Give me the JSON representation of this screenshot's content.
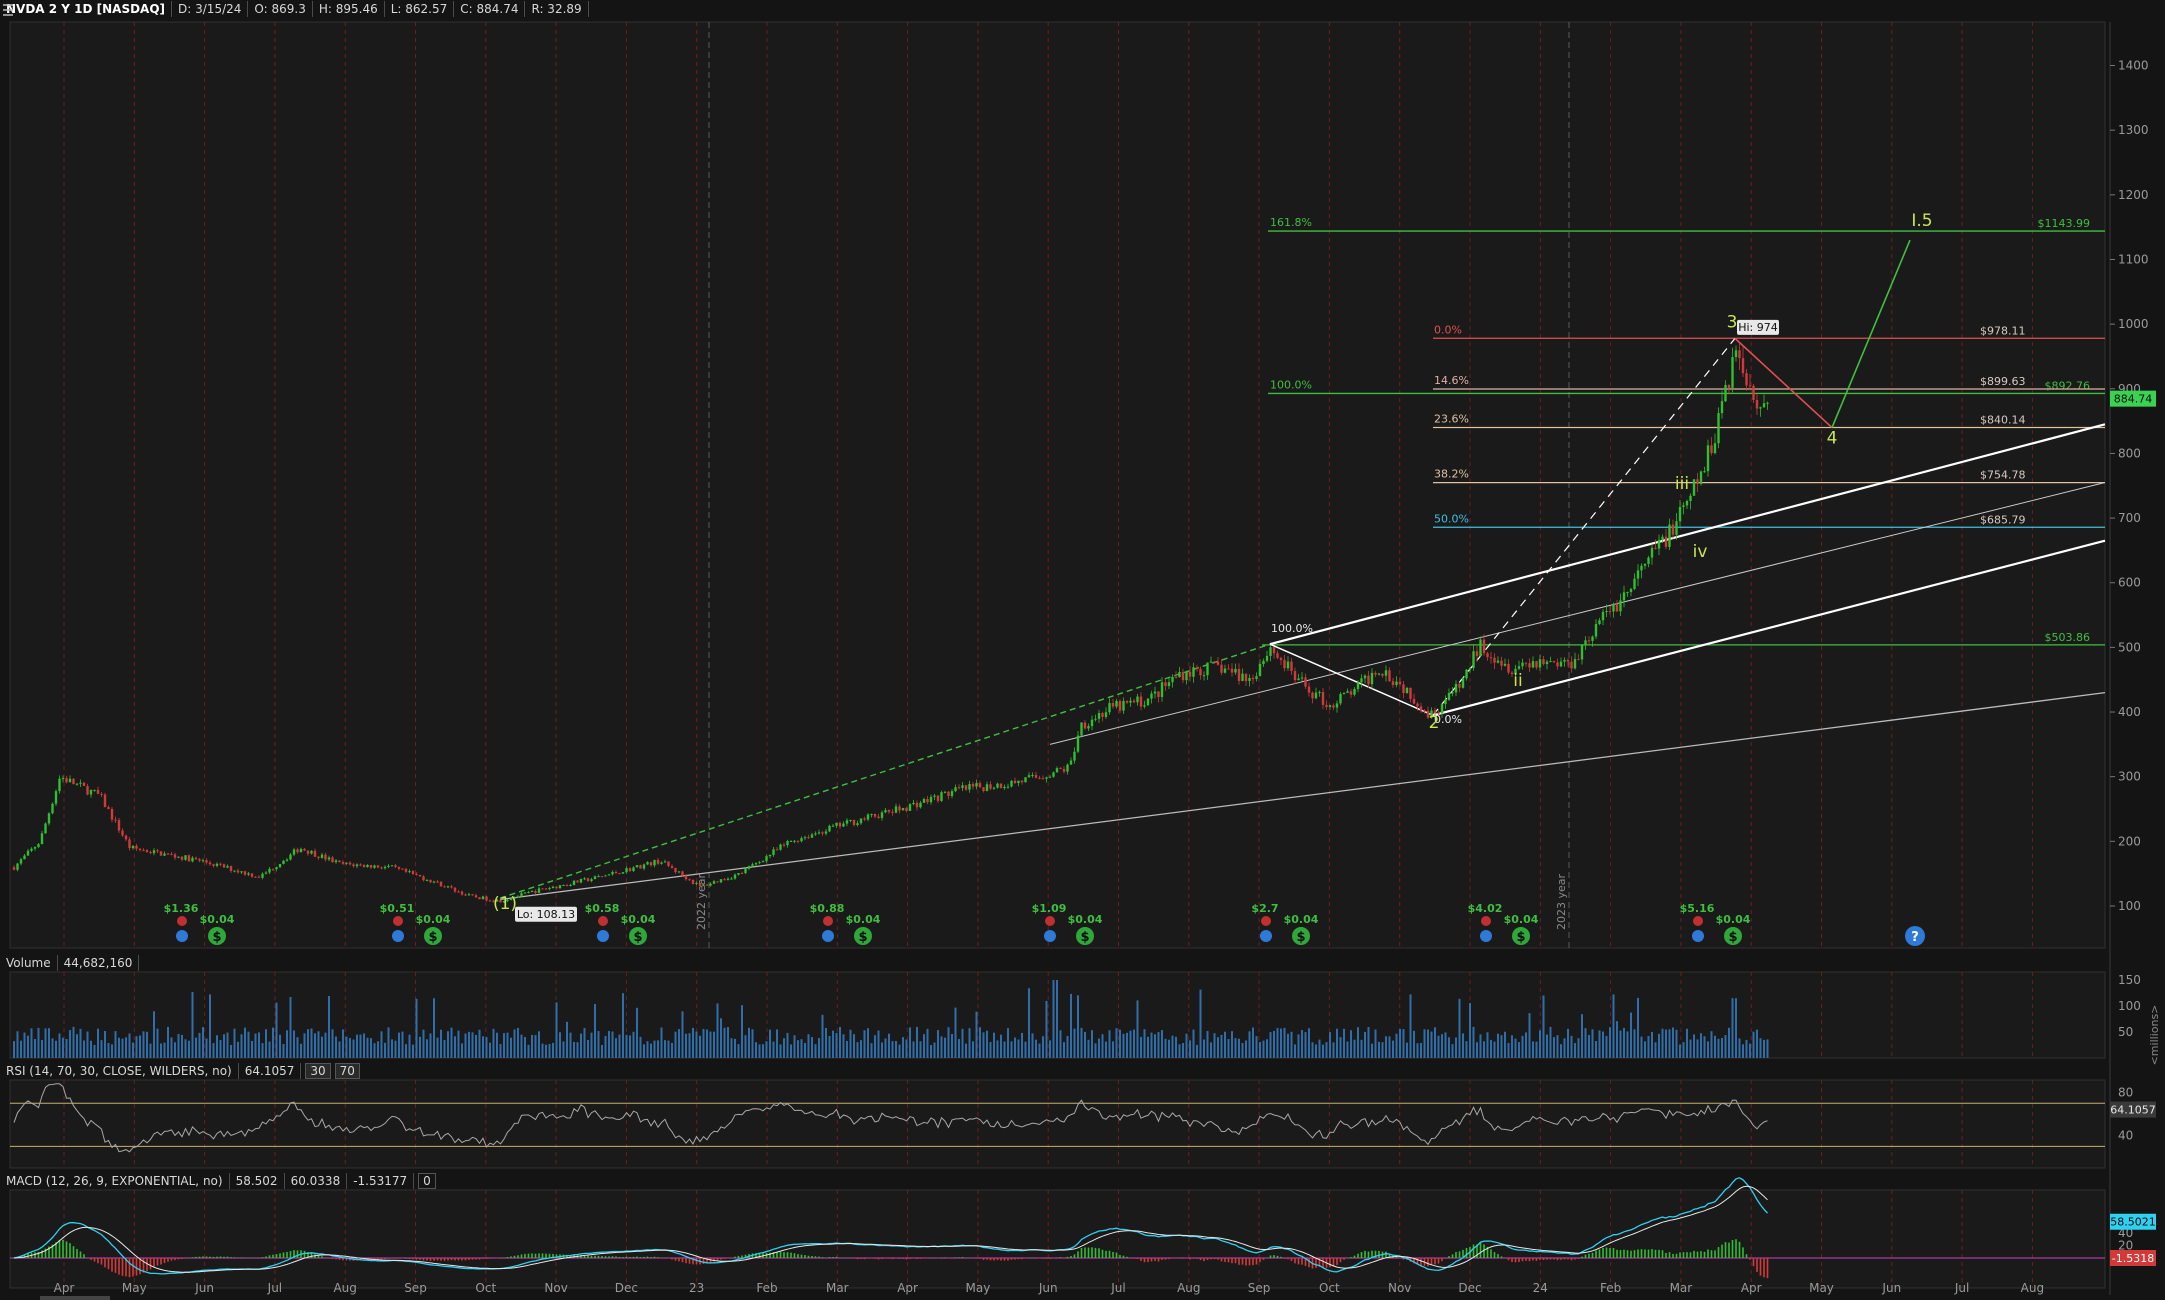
{
  "header": {
    "symbol": "NVDA 2 Y 1D [NASDAQ]",
    "date": "D: 3/15/24",
    "open": "O: 869.3",
    "high": "H: 895.46",
    "low": "L: 862.57",
    "close": "C: 884.74",
    "range": "R: 32.89"
  },
  "price_axis": {
    "ticks": [
      "1400",
      "1300",
      "1200",
      "1100",
      "1000",
      "900",
      "800",
      "700",
      "600",
      "500",
      "400",
      "300",
      "200",
      "100"
    ],
    "last_price": "884.74"
  },
  "x_axis": {
    "months": [
      "Apr",
      "May",
      "Jun",
      "Jul",
      "Aug",
      "Sep",
      "Oct",
      "Nov",
      "Dec",
      "23",
      "Feb",
      "Mar",
      "Apr",
      "May",
      "Jun",
      "Jul",
      "Aug",
      "Sep",
      "Oct",
      "Nov",
      "Dec",
      "24",
      "Feb",
      "Mar",
      "Apr",
      "May",
      "Jun",
      "Jul",
      "Aug"
    ],
    "year_labels": [
      "2022 year",
      "2023 year"
    ]
  },
  "fib_upper": [
    {
      "pct": "161.8%",
      "price": "$1143.99",
      "color": "#3fbf3f"
    },
    {
      "pct": "100.0%",
      "price": "$892.76",
      "color": "#3fbf3f"
    },
    {
      "pct": "",
      "price": "$503.86",
      "color": "#3fbf3f"
    }
  ],
  "fib_retrace": [
    {
      "pct": "0.0%",
      "price": "$978.11",
      "color": "#e05050"
    },
    {
      "pct": "14.6%",
      "price": "$899.63",
      "color": "#e0b0a0"
    },
    {
      "pct": "23.6%",
      "price": "$840.14",
      "color": "#e0c0a0"
    },
    {
      "pct": "38.2%",
      "price": "$754.78",
      "color": "#e0c0a0"
    },
    {
      "pct": "50.0%",
      "price": "$685.79",
      "color": "#3fc0e0"
    }
  ],
  "markers": {
    "hi_label": "Hi: 974",
    "lo_label": "Lo: 108.13",
    "fib_100_mid": "100.0%",
    "fib_0_mid": "0.0%"
  },
  "waves": {
    "w1": "(1)",
    "w2": "2",
    "w3": "3",
    "w4": "4",
    "w5": "I.5",
    "ii": "ii",
    "iii": "iii",
    "iv": "iv"
  },
  "events": [
    {
      "div": "$1.36",
      "small": "$0.04"
    },
    {
      "div": "$0.51",
      "small": "$0.04"
    },
    {
      "div": "$0.58",
      "small": "$0.04"
    },
    {
      "div": "$0.88",
      "small": "$0.04"
    },
    {
      "div": "$1.09",
      "small": "$0.04"
    },
    {
      "div": "$2.7",
      "small": "$0.04"
    },
    {
      "div": "$4.02",
      "small": "$0.04"
    },
    {
      "div": "$5.16",
      "small": "$0.04"
    }
  ],
  "volume": {
    "label": "Volume",
    "value": "44,682,160",
    "ticks": [
      "150",
      "100",
      "50"
    ],
    "unit": "<millions>"
  },
  "rsi": {
    "label": "RSI (14, 70, 30, CLOSE, WILDERS, no)",
    "value": "64.1057",
    "low": "30",
    "high": "70",
    "ticks": [
      "80",
      "40"
    ],
    "last": "64.1057"
  },
  "macd": {
    "label": "MACD (12, 26, 9, EXPONENTIAL, no)",
    "value": "58.502",
    "avg": "60.0338",
    "diff": "-1.53177",
    "zero": "0",
    "ticks": [
      "40",
      "20"
    ],
    "last_value": "58.5021",
    "last_diff": "-1.5318"
  },
  "colors": {
    "background": "#141414",
    "up": "#2fbf2f",
    "down": "#d23a3a",
    "volume": "#2f6ea8",
    "fib_green": "#3fbf3f",
    "fib_red": "#e05050",
    "fib_cyan": "#3fc0e0",
    "price_badge": "#39d353"
  }
}
